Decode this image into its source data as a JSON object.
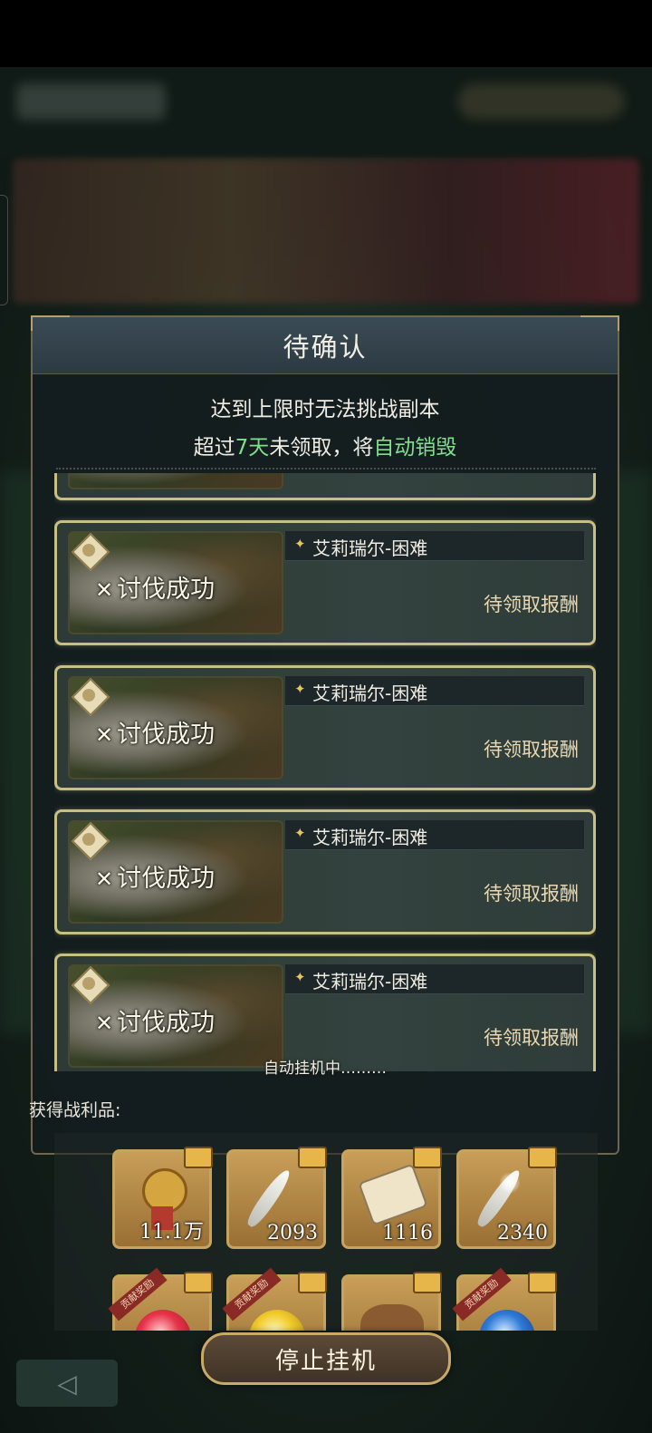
{
  "dialog": {
    "title": "待确认",
    "notice_line1": "达到上限时无法挑战副本",
    "notice_line2_prefix": "超过",
    "notice_line2_days": "7天",
    "notice_line2_middle": "未领取，将",
    "notice_line2_action": "自动销毁"
  },
  "entries": [
    {
      "result": "讨伐成功",
      "name": "艾莉瑞尔-困难",
      "status": "待领取报酬"
    },
    {
      "result": "讨伐成功",
      "name": "艾莉瑞尔-困难",
      "status": "待领取报酬"
    },
    {
      "result": "讨伐成功",
      "name": "艾莉瑞尔-困难",
      "status": "待领取报酬"
    },
    {
      "result": "讨伐成功",
      "name": "艾莉瑞尔-困难",
      "status": "待领取报酬"
    }
  ],
  "auto_hang_status": "自动挂机中………",
  "loot": {
    "label": "获得战利品:",
    "items": [
      {
        "icon": "medal-icon",
        "qty": "11.1万"
      },
      {
        "icon": "feather-icon",
        "qty": "2093"
      },
      {
        "icon": "scroll-icon",
        "qty": "1116"
      },
      {
        "icon": "shining-feather-icon",
        "qty": "2340"
      }
    ],
    "ribbon_text": "贡献奖励"
  },
  "stop_button": "停止挂机",
  "colors": {
    "accent_green": "#7fe08a",
    "frame_gold": "#c8bf86"
  }
}
